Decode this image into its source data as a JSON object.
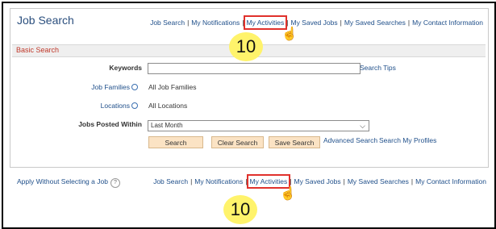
{
  "page": {
    "title": "Job Search"
  },
  "nav": {
    "job_search": "Job Search",
    "my_notifications": "My Notifications",
    "my_activities": "My Activities",
    "my_saved_jobs": "My Saved Jobs",
    "my_saved_searches": "My Saved Searches",
    "my_contact_information": "My Contact Information",
    "separator": "|"
  },
  "section": {
    "basic_search": "Basic Search"
  },
  "form": {
    "keywords_label": "Keywords",
    "keywords_value": "",
    "search_tips": "Search Tips",
    "job_families_label": "Job Families",
    "job_families_value": "All Job Families",
    "locations_label": "Locations",
    "locations_value": "All Locations",
    "posted_within_label": "Jobs Posted Within",
    "posted_within_value": "Last Month"
  },
  "buttons": {
    "search": "Search",
    "clear_search": "Clear Search",
    "save_search": "Save Search"
  },
  "links": {
    "advanced_search": "Advanced Search",
    "search_my_profiles": "Search My Profiles",
    "apply_without_selecting": "Apply Without Selecting a Job"
  },
  "callouts": {
    "step_top": "10",
    "step_bottom": "10"
  },
  "icons": {
    "lookup": "magnifier-icon",
    "help": "help-icon",
    "cursor": "hand-pointer-icon"
  },
  "colors": {
    "highlight": "#e0312c",
    "badge": "#fff36b",
    "button": "#fbe3c4",
    "link": "#1f4f8a"
  }
}
